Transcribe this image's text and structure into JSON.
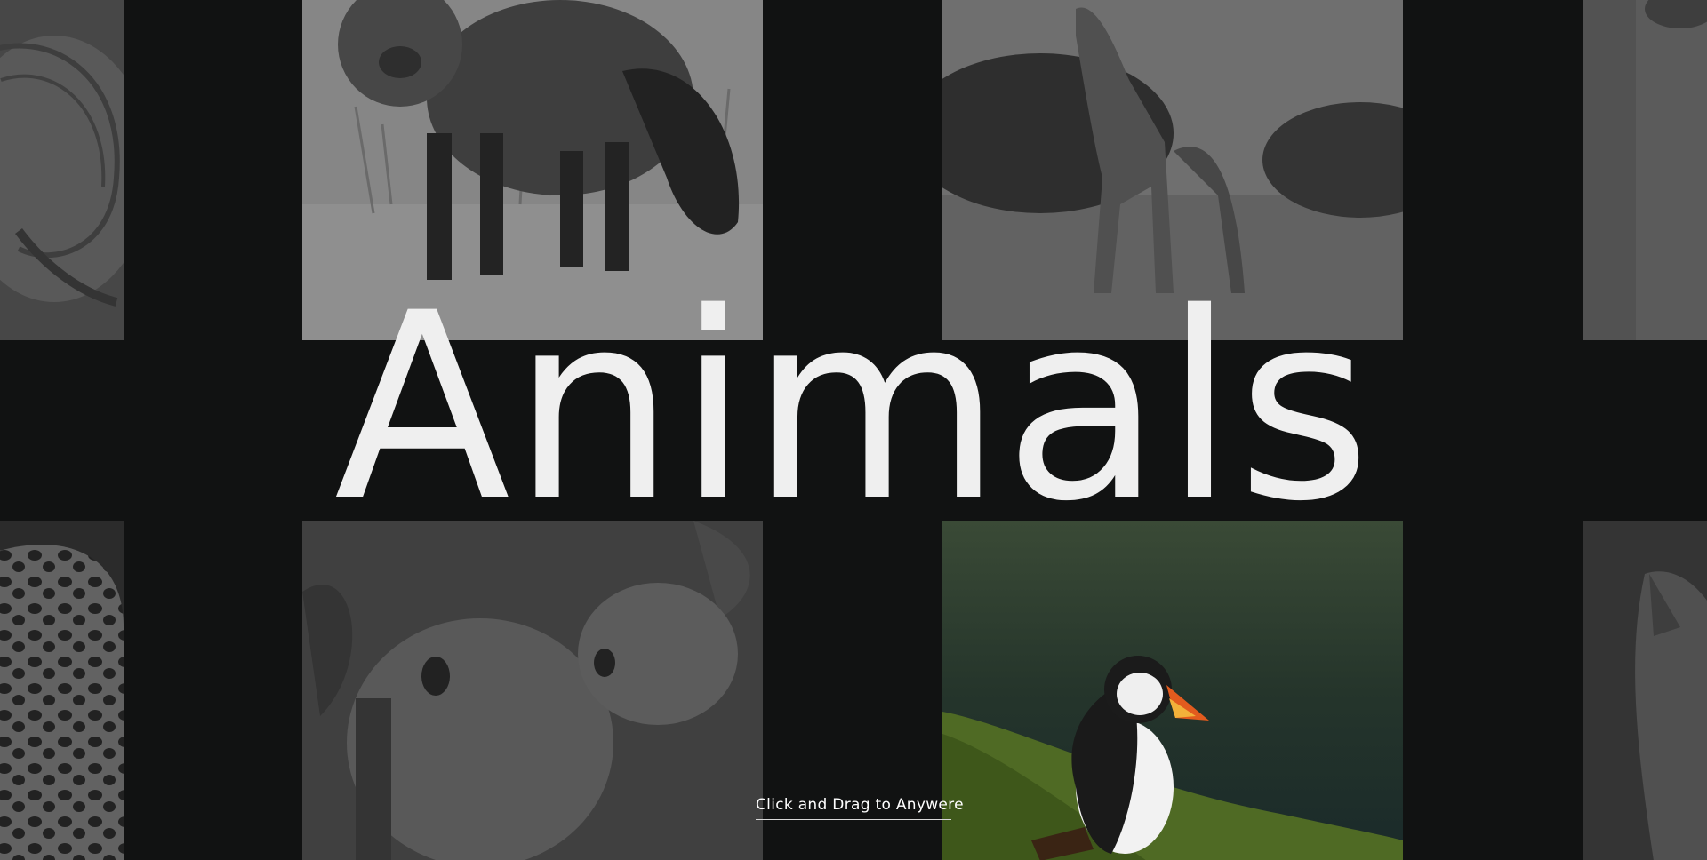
{
  "page": {
    "title": "Animals",
    "hint": "Click and Drag to Anywere"
  },
  "gallery": {
    "tiles": [
      {
        "subject": "flamingo",
        "state": "dimmed"
      },
      {
        "subject": "fox",
        "state": "dimmed"
      },
      {
        "subject": "giraffe",
        "state": "dimmed"
      },
      {
        "subject": "bird",
        "state": "dimmed"
      },
      {
        "subject": "leopard",
        "state": "dimmed"
      },
      {
        "subject": "koala",
        "state": "dimmed"
      },
      {
        "subject": "puffin",
        "state": "active"
      },
      {
        "subject": "cat",
        "state": "dimmed"
      }
    ]
  },
  "colors": {
    "background": "#111212",
    "title": "#efefef",
    "hint": "#ffffff"
  }
}
